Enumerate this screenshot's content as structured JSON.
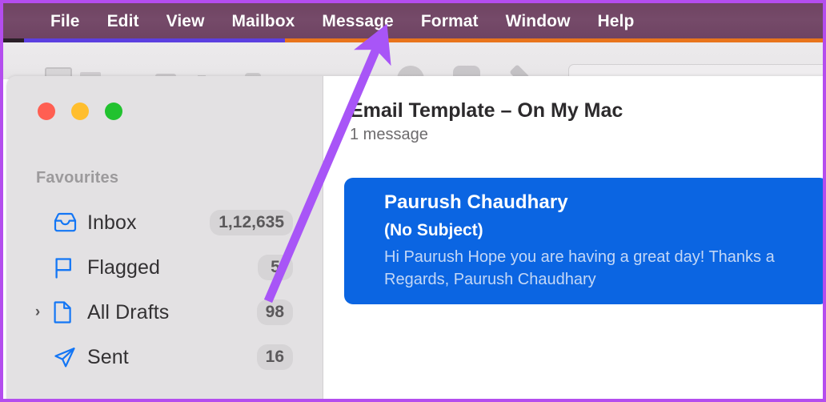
{
  "menubar": {
    "items": [
      {
        "label": "File"
      },
      {
        "label": "Edit"
      },
      {
        "label": "View"
      },
      {
        "label": "Mailbox"
      },
      {
        "label": "Message"
      },
      {
        "label": "Format"
      },
      {
        "label": "Window"
      },
      {
        "label": "Help"
      }
    ],
    "background_color": "#714767",
    "text_color": "#ffffff"
  },
  "accents": {
    "blue": "#5b3fe0",
    "orange": "#e8741c"
  },
  "window_controls": {
    "close": "close-button",
    "minimize": "minimize-button",
    "maximize": "maximize-button",
    "close_color": "#ff5f52",
    "minimize_color": "#ffbe2e",
    "maximize_color": "#22c22f"
  },
  "sidebar": {
    "section_title": "Favourites",
    "items": [
      {
        "label": "Inbox",
        "badge": "1,12,635",
        "icon": "inbox-icon",
        "has_disclosure": false
      },
      {
        "label": "Flagged",
        "badge": "5",
        "icon": "flag-icon",
        "has_disclosure": false
      },
      {
        "label": "All Drafts",
        "badge": "98",
        "icon": "document-icon",
        "has_disclosure": true
      },
      {
        "label": "Sent",
        "badge": "16",
        "icon": "paper-plane-icon",
        "has_disclosure": false
      }
    ],
    "icon_color": "#1376f5",
    "background_color": "#e3e1e3"
  },
  "main": {
    "title": "Email Template – On My Mac",
    "message_count": "1 message",
    "message": {
      "sender": "Paurush Chaudhary",
      "subject": "(No Subject)",
      "preview_line1": "Hi Paurush Hope you are having a great day! Thanks a",
      "preview_line2": "Regards, Paurush Chaudhary",
      "selected_color": "#0b65e2"
    }
  },
  "annotation": {
    "arrow_color": "#a855f7",
    "arrow_points_to": "Message",
    "border_color": "#b44dee"
  }
}
